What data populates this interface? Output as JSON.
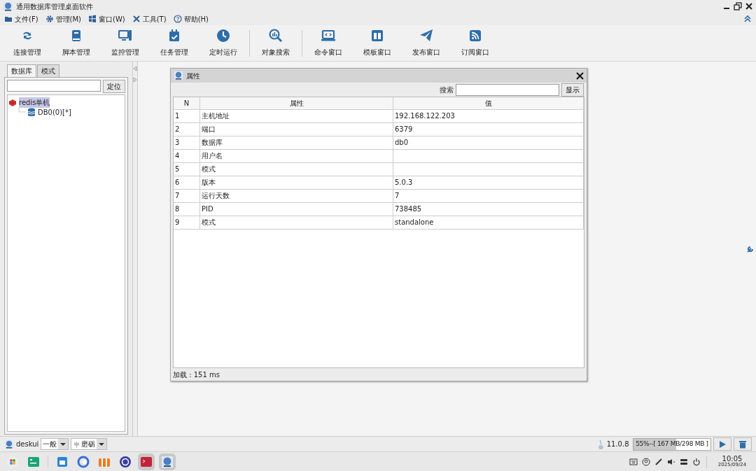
{
  "window": {
    "title": "通用数据库管理桌面软件"
  },
  "menu": [
    {
      "label": "文件(F)"
    },
    {
      "label": "管理(M)"
    },
    {
      "label": "窗口(W)"
    },
    {
      "label": "工具(T)"
    },
    {
      "label": "帮助(H)"
    }
  ],
  "toolbar": [
    {
      "label": "连接管理",
      "separator_before": false
    },
    {
      "label": "脚本管理",
      "separator_before": false
    },
    {
      "label": "监控管理",
      "separator_before": false
    },
    {
      "label": "任务管理",
      "separator_before": false
    },
    {
      "label": "定时运行",
      "separator_before": false
    },
    {
      "label": "对象搜索",
      "separator_before": true
    },
    {
      "label": "命令窗口",
      "separator_before": true
    },
    {
      "label": "模板窗口",
      "separator_before": false
    },
    {
      "label": "发布窗口",
      "separator_before": false
    },
    {
      "label": "订阅窗口",
      "separator_before": false
    }
  ],
  "sidebar": {
    "tabs": [
      {
        "label": "数据库",
        "selected": true
      },
      {
        "label": "模式",
        "selected": false
      }
    ],
    "locate_button": "定位",
    "tree": [
      {
        "label": "redis单机",
        "selected": true,
        "children": [
          {
            "label": "DB0(0)[*]",
            "selected": false
          }
        ]
      }
    ]
  },
  "dialog": {
    "title": "属性",
    "search_label": "搜索",
    "show_button": "显示",
    "columns": [
      "N",
      "属性",
      "值"
    ],
    "rows": [
      [
        "1",
        "主机地址",
        "192.168.122.203"
      ],
      [
        "2",
        "端口",
        "6379"
      ],
      [
        "3",
        "数据库",
        "db0"
      ],
      [
        "4",
        "用户名",
        ""
      ],
      [
        "5",
        "模式",
        ""
      ],
      [
        "6",
        "版本",
        "5.0.3"
      ],
      [
        "7",
        "运行天数",
        "7"
      ],
      [
        "8",
        "PID",
        "738485"
      ],
      [
        "9",
        "模式",
        "standalone"
      ]
    ],
    "footer": "加载 : 151 ms"
  },
  "status_bar": {
    "user": "deskui",
    "level_select": "一般",
    "theme_select": "磨砺",
    "java_version": "11.0.8",
    "memory": {
      "text": "55%--[ 167 MB/298 MB ]",
      "level": 0.55
    }
  },
  "taskbar": {
    "apps": [
      {
        "active": false
      },
      {
        "active": false
      },
      {
        "active": false
      },
      {
        "active": false
      },
      {
        "active": false
      },
      {
        "active": false
      },
      {
        "active": true
      },
      {
        "active": true
      }
    ],
    "time": "10:05",
    "date": "2025/09/24"
  }
}
